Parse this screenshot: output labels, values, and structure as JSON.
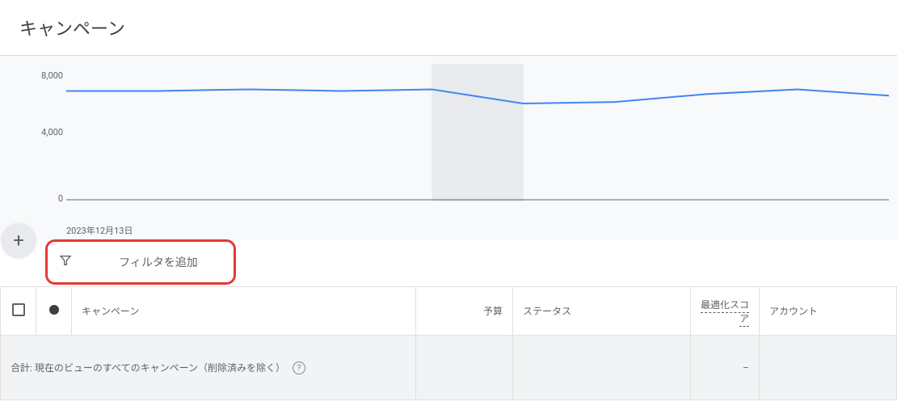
{
  "header": {
    "title": "キャンペーン"
  },
  "chart_data": {
    "type": "line",
    "x": [
      0,
      1,
      2,
      3,
      4,
      5,
      6,
      7,
      8,
      9
    ],
    "values": [
      6900,
      6900,
      7000,
      6900,
      7000,
      6100,
      6200,
      6700,
      7000,
      6600
    ],
    "ylim": [
      0,
      8000
    ],
    "yticks": [
      0,
      4000,
      8000
    ],
    "ytick_labels": [
      "0",
      "4,000",
      "8,000"
    ],
    "xlabel_start": "2023年12月13日",
    "highlight_range": [
      4,
      5
    ]
  },
  "fab": {
    "label": "+"
  },
  "filter": {
    "label": "フィルタを追加"
  },
  "table": {
    "headers": {
      "campaign": "キャンペーン",
      "budget": "予算",
      "status": "ステータス",
      "opt_score": "最適化スコア",
      "account": "アカウント"
    },
    "summary": {
      "label": "合計: 現在のビューのすべてのキャンペーン（削除済みを除く）",
      "opt_score": "–"
    }
  }
}
